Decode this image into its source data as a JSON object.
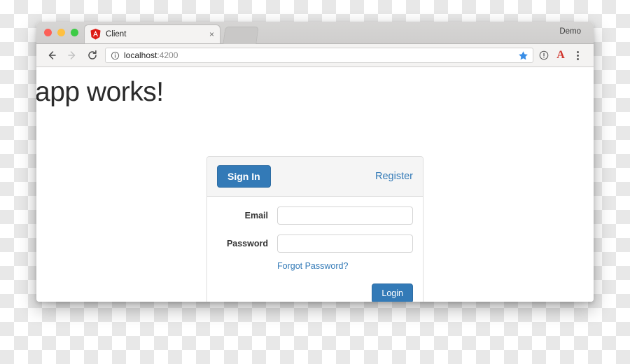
{
  "browser": {
    "window_controls": [
      {
        "name": "close",
        "color": "#fc6058"
      },
      {
        "name": "minimize",
        "color": "#fec041"
      },
      {
        "name": "maximize",
        "color": "#3dcb46"
      }
    ],
    "tab": {
      "title": "Client",
      "favicon": "angular-logo-icon",
      "close_label": "×"
    },
    "profile_label": "Demo",
    "toolbar": {
      "back_icon": "back-arrow-icon",
      "forward_icon": "forward-arrow-icon",
      "reload_icon": "reload-icon",
      "omnibox": {
        "security_icon": "info-circle-icon",
        "host": "localhost",
        "port": ":4200",
        "full_url": "localhost:4200",
        "bookmark_icon": "star-icon",
        "bookmark_color": "#3a8ee6"
      },
      "page_info_icon": "info-circle-icon",
      "extension_icon": "letter-a-extension-icon",
      "extension_letter": "A",
      "menu_icon": "kebab-menu-icon"
    }
  },
  "page": {
    "heading": "app works!",
    "auth_card": {
      "tabs": {
        "signin_label": "Sign In",
        "register_label": "Register"
      },
      "fields": [
        {
          "label": "Email",
          "value": "",
          "placeholder": "",
          "type": "text"
        },
        {
          "label": "Password",
          "value": "",
          "placeholder": "",
          "type": "password"
        }
      ],
      "forgot_password_label": "Forgot Password?",
      "submit_label": "Login"
    }
  },
  "colors": {
    "primary": "#337ab7",
    "primary_border": "#2e6da4",
    "link": "#337ab7",
    "card_header_bg": "#f5f5f5",
    "card_border": "#dddddd",
    "heading_text": "#2b2b2b"
  }
}
